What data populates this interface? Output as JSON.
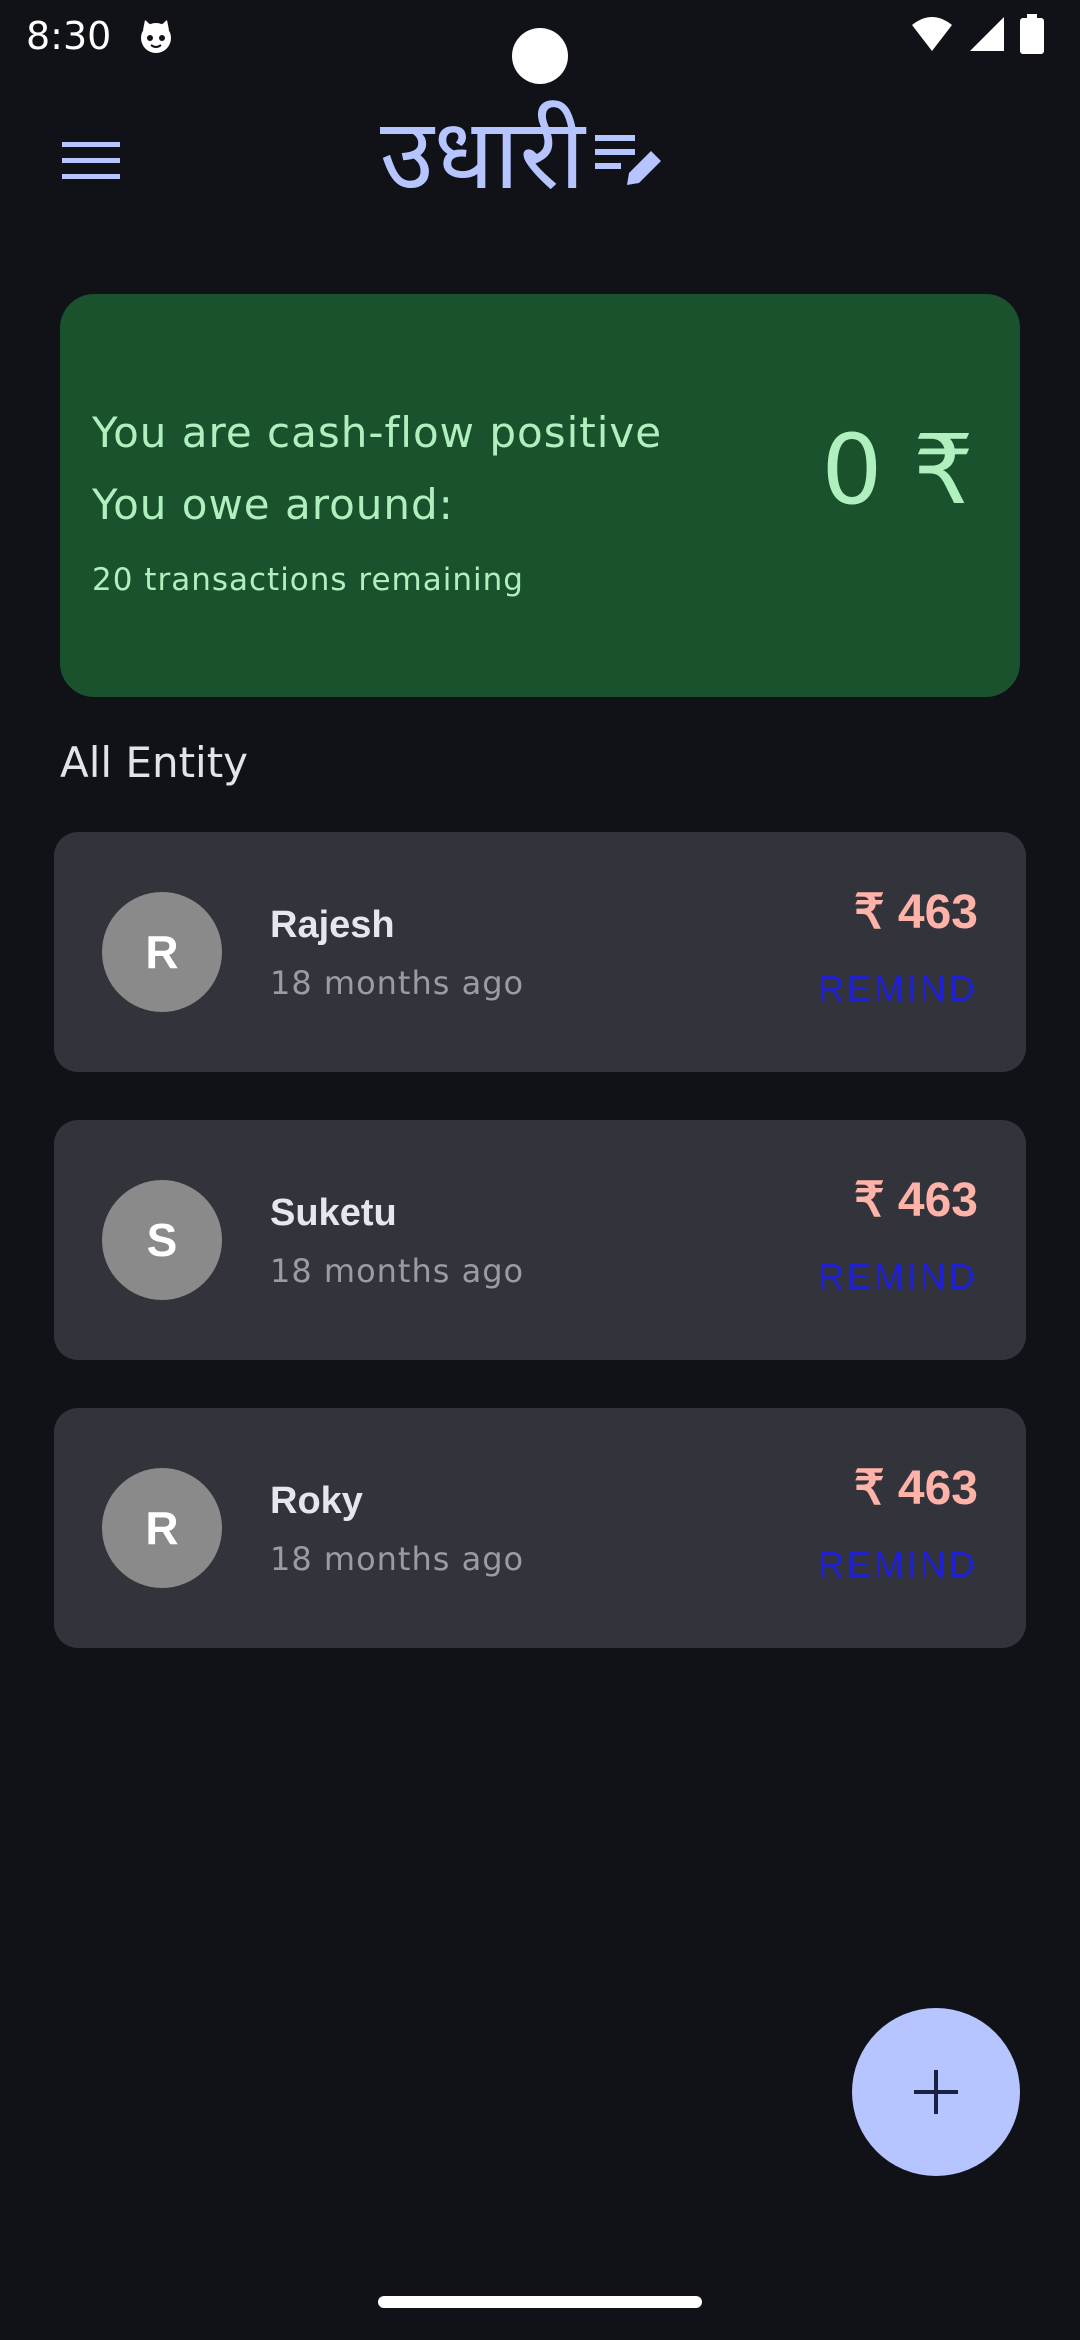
{
  "status_bar": {
    "time": "8:30",
    "icons": [
      "cat-icon",
      "wifi-icon",
      "signal-icon",
      "battery-icon"
    ]
  },
  "header": {
    "title": "उधारी",
    "menu_icon": "menu-icon",
    "logo_icon": "edit-note-icon"
  },
  "summary": {
    "line1": "You are cash-flow positive",
    "line2": "You owe around:",
    "line3": "20 transactions remaining",
    "amount": "0 ₹"
  },
  "section": {
    "title": "All Entity"
  },
  "entities": [
    {
      "initial": "R",
      "name": "Rajesh",
      "time": "18 months ago",
      "amount": "₹ 463",
      "action": "REMIND"
    },
    {
      "initial": "S",
      "name": "Suketu",
      "time": "18 months ago",
      "amount": "₹ 463",
      "action": "REMIND"
    },
    {
      "initial": "R",
      "name": "Roky",
      "time": "18 months ago",
      "amount": "₹ 463",
      "action": "REMIND"
    }
  ],
  "fab": {
    "icon": "plus-icon"
  },
  "colors": {
    "background": "#111217",
    "summary_card": "#19522c",
    "summary_text": "#b0f0bf",
    "accent": "#b6c4ff",
    "entity_card": "#33343b",
    "amount": "#ffb3a8",
    "remind": "#1f1fd6"
  }
}
